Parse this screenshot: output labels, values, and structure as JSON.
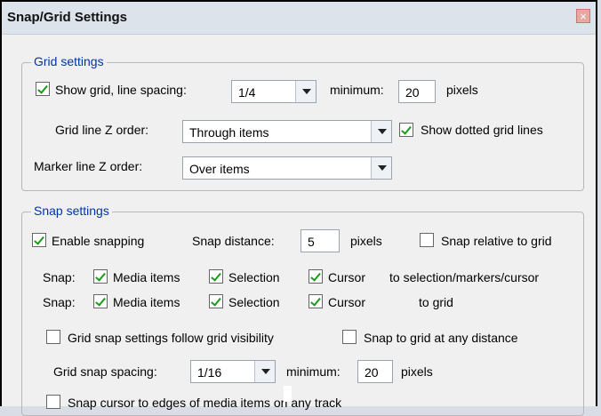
{
  "window": {
    "title": "Snap/Grid Settings",
    "close_glyph": "×"
  },
  "grid_settings": {
    "group_label": "Grid settings",
    "show_grid": {
      "label": "Show grid, line spacing:",
      "checked": true
    },
    "line_spacing": {
      "value": "1/4"
    },
    "minimum_label": "minimum:",
    "minimum_value": "20",
    "pixels_label": "pixels",
    "grid_line_z_order": {
      "label": "Grid line Z order:",
      "value": "Through items"
    },
    "show_dotted": {
      "label": "Show dotted grid lines",
      "checked": true
    },
    "marker_line_z_order": {
      "label": "Marker line Z order:",
      "value": "Over items"
    }
  },
  "snap_settings": {
    "group_label": "Snap settings",
    "enable_snapping": {
      "label": "Enable snapping",
      "checked": true
    },
    "snap_distance_label": "Snap distance:",
    "snap_distance_value": "5",
    "pixels_label": "pixels",
    "snap_relative": {
      "label": "Snap relative to grid",
      "checked": false
    },
    "row1": {
      "prefix": "Snap:",
      "media": "Media items",
      "selection": "Selection",
      "cursor": "Cursor",
      "target": "to selection/markers/cursor"
    },
    "row2": {
      "prefix": "Snap:",
      "media": "Media items",
      "selection": "Selection",
      "cursor": "Cursor",
      "target": "to grid"
    },
    "follow_visibility": {
      "label": "Grid snap settings follow grid visibility",
      "checked": false
    },
    "any_distance": {
      "label": "Snap to grid at any distance",
      "checked": false
    },
    "grid_snap_spacing_label": "Grid snap spacing:",
    "grid_snap_spacing_value": "1/16",
    "minimum_label": "minimum:",
    "minimum_value": "20",
    "pixels_label2": "pixels",
    "snap_cursor_edges": {
      "label": "Snap cursor to edges of media items on any track",
      "checked": false
    }
  }
}
